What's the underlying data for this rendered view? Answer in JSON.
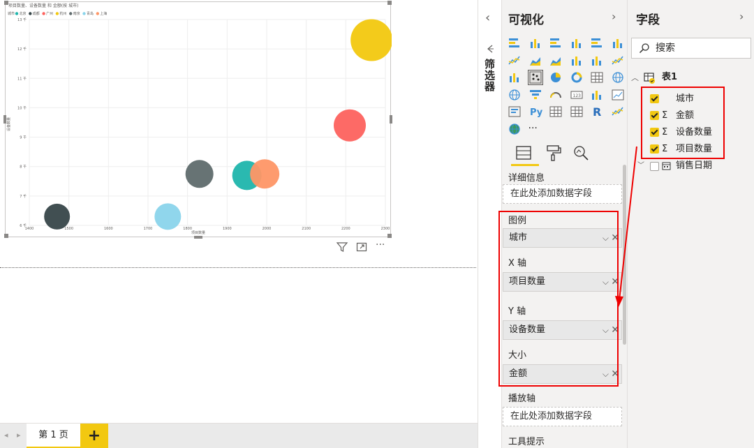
{
  "canvas": {
    "chart_title": "项目数量、设备数量 和 金额(按 城市)",
    "legend_title": "城市",
    "page_tab": "第 1 页",
    "add_page": "+",
    "toolbar": {
      "filter_icon": "filter-icon",
      "focus_icon": "focus-mode-icon",
      "more": "···"
    }
  },
  "chart_data": {
    "type": "scatter",
    "title": "项目数量、设备数量 和 金额(按 城市)",
    "xlabel": "项目数量",
    "ylabel": "设备数量",
    "xlim": [
      1400,
      2300
    ],
    "ylim": [
      6000,
      13000
    ],
    "x_ticks": [
      "1400",
      "1500",
      "1600",
      "1700",
      "1800",
      "1900",
      "2000",
      "2100",
      "2200",
      "2300"
    ],
    "y_ticks": [
      "13 千",
      "12 千",
      "11 千",
      "10 千",
      "9 千",
      "8 千",
      "7 千",
      "6 千"
    ],
    "y_tick_values": [
      13000,
      12000,
      11000,
      10000,
      9000,
      8000,
      7000,
      6000
    ],
    "legend_position": "top-left",
    "grid": true,
    "series": [
      {
        "name": "北京",
        "color": "#1fb5ac",
        "x": 1950,
        "y": 7700,
        "size": 42
      },
      {
        "name": "成都",
        "color": "#374649",
        "x": 1470,
        "y": 6300,
        "size": 37
      },
      {
        "name": "广州",
        "color": "#fd625e",
        "x": 2210,
        "y": 9400,
        "size": 46
      },
      {
        "name": "杭州",
        "color": "#f2c80f",
        "x": 2265,
        "y": 12300,
        "size": 60
      },
      {
        "name": "南京",
        "color": "#5f6b6d",
        "x": 1830,
        "y": 7750,
        "size": 40
      },
      {
        "name": "青岛",
        "color": "#8ad4eb",
        "x": 1750,
        "y": 6300,
        "size": 38
      },
      {
        "name": "上海",
        "color": "#fe9666",
        "x": 1995,
        "y": 7750,
        "size": 42
      }
    ]
  },
  "filters": {
    "label": "筛选器",
    "expand_icon": "chevron-left-icon",
    "hide_icon": "eye-hide-icon"
  },
  "visualizations": {
    "title": "可视化",
    "chevron": "›",
    "more": "···",
    "tabs": [
      "fields-tab",
      "format-tab",
      "analytics-tab"
    ],
    "wells": {
      "details_label": "详细信息",
      "details_placeholder": "在此处添加数据字段",
      "legend_label": "图例",
      "legend_value": "城市",
      "x_label": "X 轴",
      "x_value": "项目数量",
      "y_label": "Y 轴",
      "y_value": "设备数量",
      "size_label": "大小",
      "size_value": "金额",
      "play_label": "播放轴",
      "play_placeholder": "在此处添加数据字段",
      "tooltip_label": "工具提示"
    },
    "chevron_glyph": "⌵",
    "remove_glyph": "✕"
  },
  "fields": {
    "title": "字段",
    "chevron": "›",
    "search_placeholder": "搜索",
    "table_name": "表1",
    "table_expand": "^",
    "items": [
      {
        "name": "城市",
        "checked": true,
        "sigma": false
      },
      {
        "name": "金额",
        "checked": true,
        "sigma": true
      },
      {
        "name": "设备数量",
        "checked": true,
        "sigma": true
      },
      {
        "name": "项目数量",
        "checked": true,
        "sigma": true
      }
    ],
    "date_table": "销售日期",
    "sigma_glyph": "Σ"
  }
}
